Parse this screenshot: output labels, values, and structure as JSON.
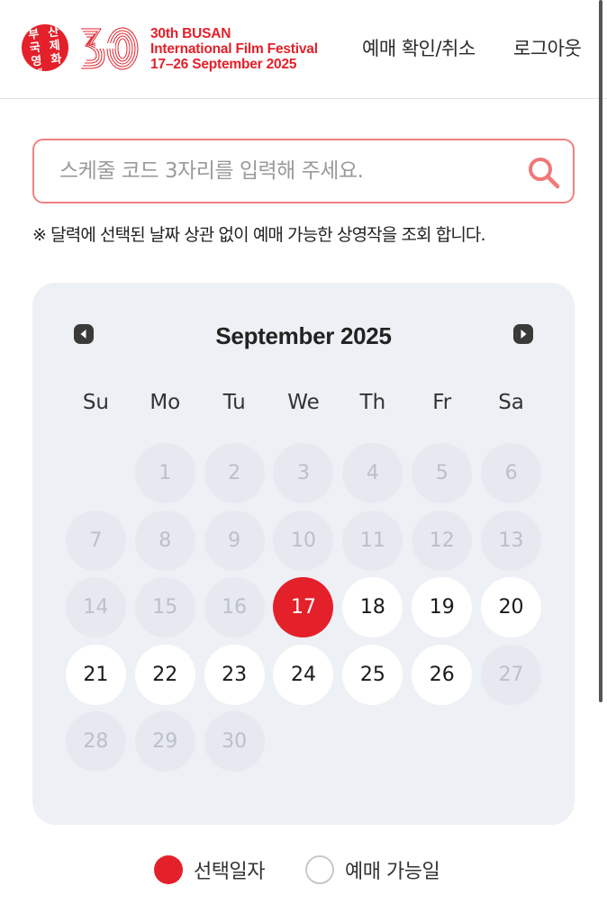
{
  "header": {
    "seal_chars": [
      "부",
      "산",
      "국",
      "제",
      "영",
      "화",
      "제",
      ""
    ],
    "festival_lines": [
      "30th BUSAN",
      "International Film Festival",
      "17–26 September 2025"
    ],
    "nav_booking": "예매 확인/취소",
    "nav_logout": "로그아웃"
  },
  "search": {
    "placeholder": "스케줄 코드 3자리를 입력해 주세요.",
    "value": ""
  },
  "notice": "※ 달력에 선택된 날짜 상관 없이 예매 가능한 상영작을 조회 합니다.",
  "calendar": {
    "month_title": "September 2025",
    "weekdays": [
      "Su",
      "Mo",
      "Tu",
      "We",
      "Th",
      "Fr",
      "Sa"
    ],
    "days": [
      {
        "label": "",
        "state": "empty"
      },
      {
        "label": "1",
        "state": "disabled"
      },
      {
        "label": "2",
        "state": "disabled"
      },
      {
        "label": "3",
        "state": "disabled"
      },
      {
        "label": "4",
        "state": "disabled"
      },
      {
        "label": "5",
        "state": "disabled"
      },
      {
        "label": "6",
        "state": "disabled"
      },
      {
        "label": "7",
        "state": "disabled"
      },
      {
        "label": "8",
        "state": "disabled"
      },
      {
        "label": "9",
        "state": "disabled"
      },
      {
        "label": "10",
        "state": "disabled"
      },
      {
        "label": "11",
        "state": "disabled"
      },
      {
        "label": "12",
        "state": "disabled"
      },
      {
        "label": "13",
        "state": "disabled"
      },
      {
        "label": "14",
        "state": "disabled"
      },
      {
        "label": "15",
        "state": "disabled"
      },
      {
        "label": "16",
        "state": "disabled"
      },
      {
        "label": "17",
        "state": "selected"
      },
      {
        "label": "18",
        "state": "available"
      },
      {
        "label": "19",
        "state": "available"
      },
      {
        "label": "20",
        "state": "available"
      },
      {
        "label": "21",
        "state": "available"
      },
      {
        "label": "22",
        "state": "available"
      },
      {
        "label": "23",
        "state": "available"
      },
      {
        "label": "24",
        "state": "available"
      },
      {
        "label": "25",
        "state": "available"
      },
      {
        "label": "26",
        "state": "available"
      },
      {
        "label": "27",
        "state": "disabled"
      },
      {
        "label": "28",
        "state": "disabled"
      },
      {
        "label": "29",
        "state": "disabled"
      },
      {
        "label": "30",
        "state": "disabled"
      }
    ]
  },
  "legend": {
    "selected_label": "선택일자",
    "available_label": "예매 가능일"
  },
  "colors": {
    "brand_red": "#e4202a",
    "search_border": "#f08080",
    "calendar_bg": "#edf0f5"
  },
  "icons": {
    "search": "search-icon",
    "prev": "chevron-left-icon",
    "next": "chevron-right-icon",
    "logo": "biff-30th-logo"
  }
}
